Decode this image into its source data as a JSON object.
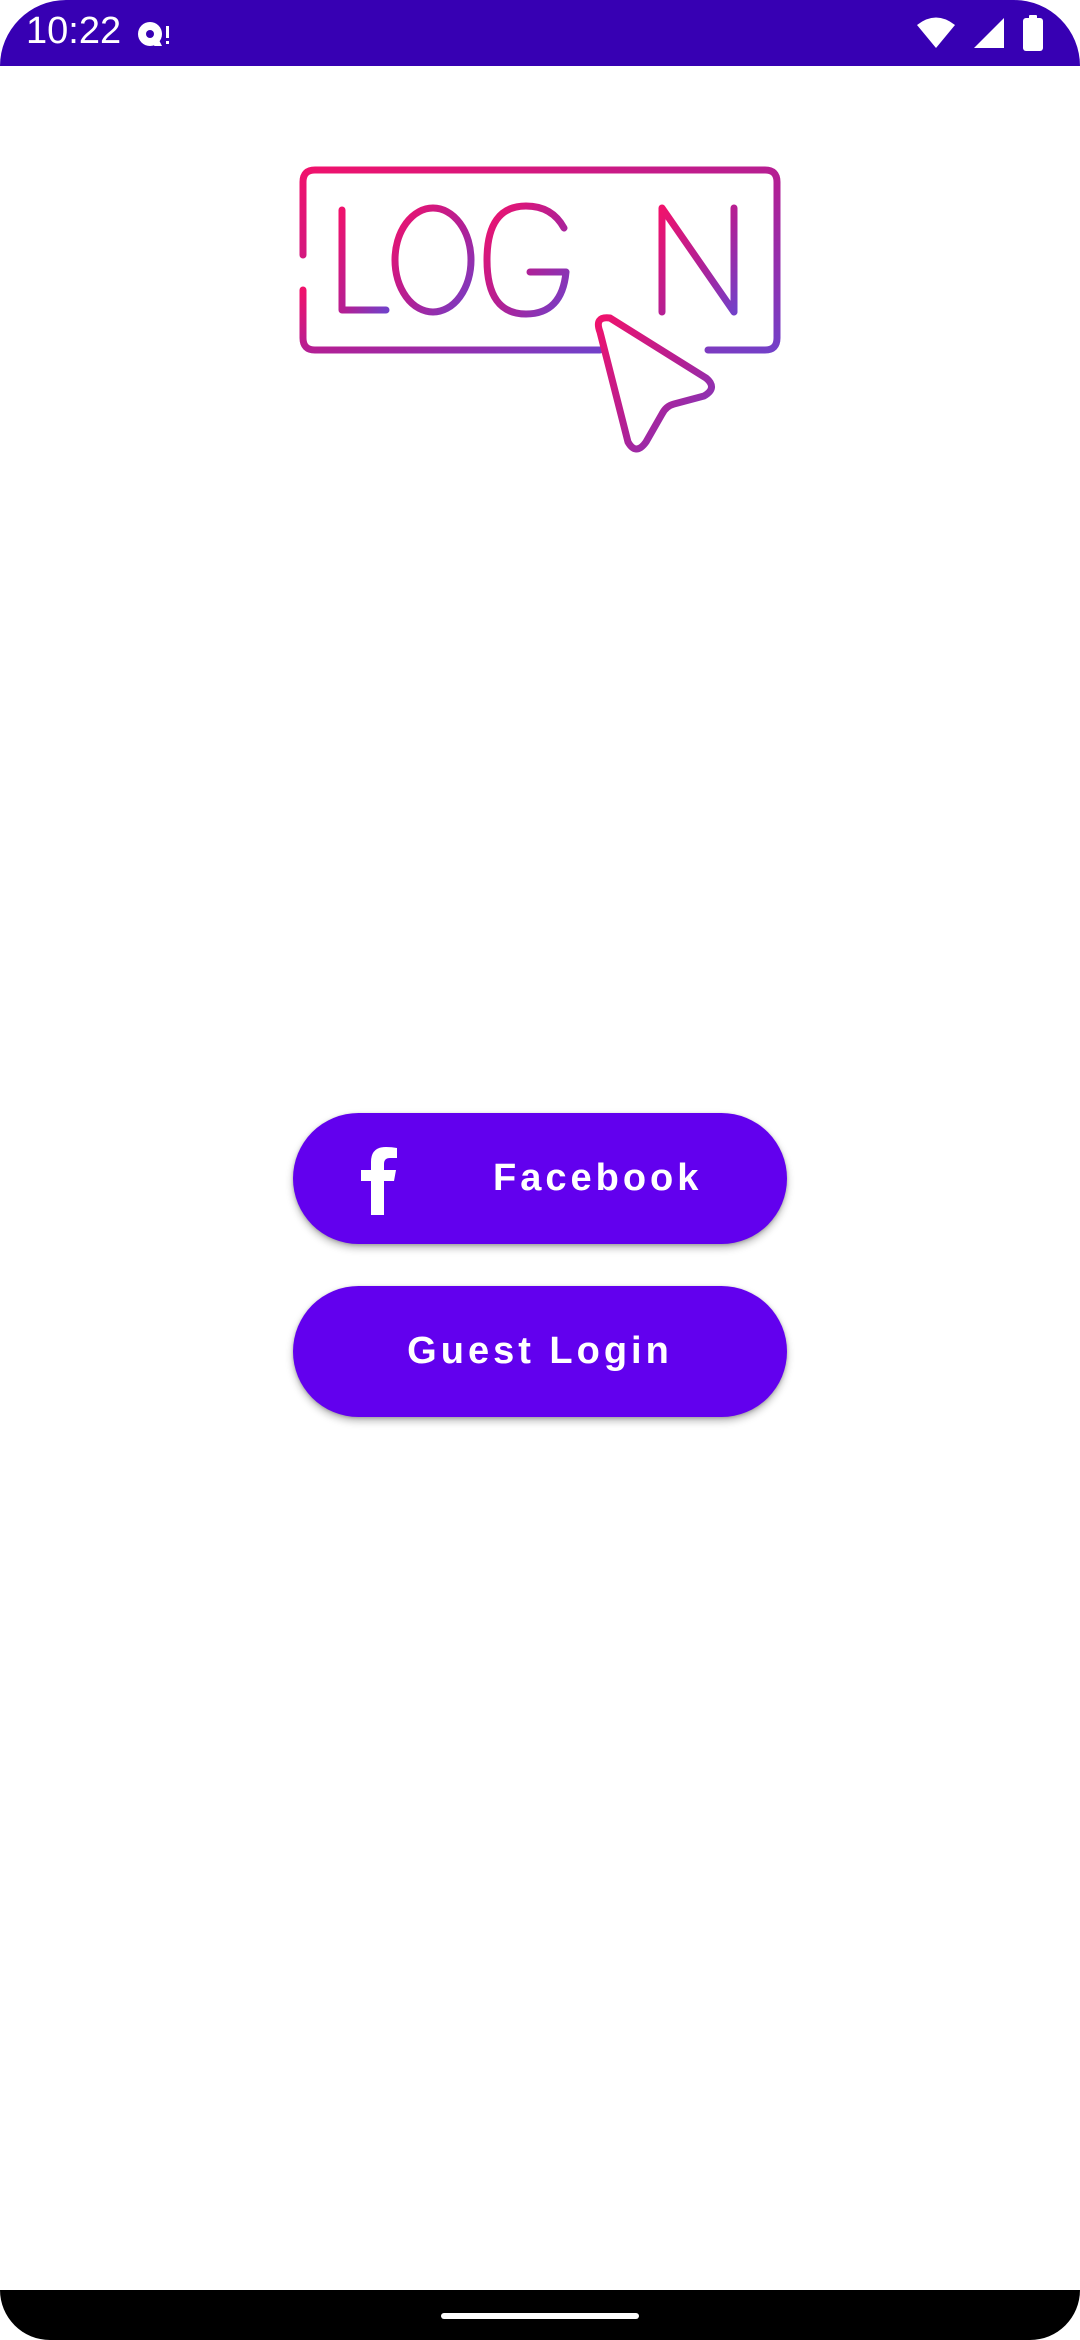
{
  "status_bar": {
    "time": "10:22",
    "background_color": "#3700B3",
    "left_icons": [
      "media-notification-icon"
    ],
    "right_icons": [
      "wifi-icon",
      "cellular-signal-icon",
      "battery-icon"
    ]
  },
  "logo": {
    "alt": "LOG IN",
    "gradient_colors": [
      "#E8116E",
      "#7B3FC4"
    ]
  },
  "buttons": {
    "facebook": {
      "label": "Facebook",
      "icon": "facebook-icon"
    },
    "guest": {
      "label": "Guest Login"
    },
    "color": "#6200EE"
  },
  "navigation_bar": {
    "handle": "gesture-handle"
  }
}
